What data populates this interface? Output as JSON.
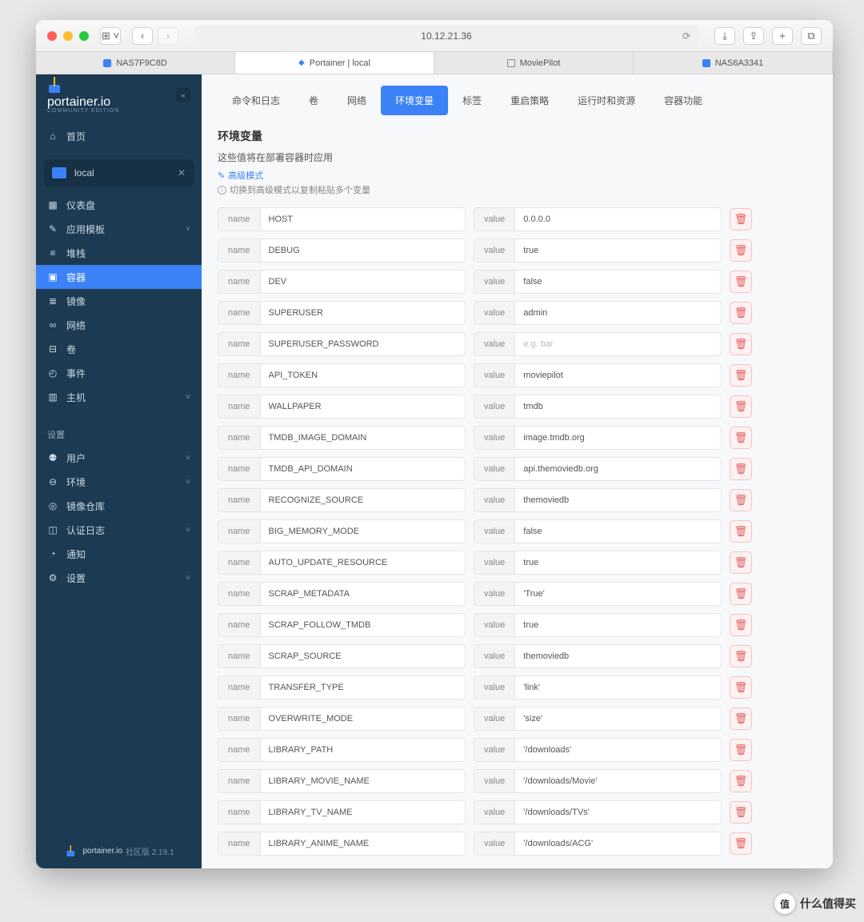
{
  "browser": {
    "url": "10.12.21.36",
    "tabs": [
      {
        "label": "NAS7F9C8D"
      },
      {
        "label": "Portainer | local"
      },
      {
        "label": "MoviePilot"
      },
      {
        "label": "NAS6A3341"
      }
    ]
  },
  "sidebar": {
    "brand": "portainer.io",
    "edition": "COMMUNITY EDITION",
    "home": "首页",
    "env": "local",
    "items": [
      {
        "icon": "▦",
        "label": "仪表盘"
      },
      {
        "icon": "✎",
        "label": "应用模板",
        "chev": true
      },
      {
        "icon": "≡",
        "label": "堆栈"
      },
      {
        "icon": "▣",
        "label": "容器",
        "sel": true
      },
      {
        "icon": "≣",
        "label": "镜像"
      },
      {
        "icon": "∞",
        "label": "网络"
      },
      {
        "icon": "⊟",
        "label": "卷"
      },
      {
        "icon": "◴",
        "label": "事件"
      },
      {
        "icon": "▥",
        "label": "主机",
        "chev": true
      }
    ],
    "settings_label": "设置",
    "settings": [
      {
        "icon": "⚉",
        "label": "用户",
        "chev": true
      },
      {
        "icon": "⊖",
        "label": "环境",
        "chev": true
      },
      {
        "icon": "◎",
        "label": "镜像仓库"
      },
      {
        "icon": "◫",
        "label": "认证日志",
        "chev": true
      },
      {
        "icon": "◔",
        "label": "通知"
      },
      {
        "icon": "⚙",
        "label": "设置",
        "chev": true
      }
    ],
    "footer_brand": "portainer.io",
    "footer_version": "社区版 2.19.1"
  },
  "content": {
    "tabs": [
      "命令和日志",
      "卷",
      "网络",
      "环境变量",
      "标签",
      "重启策略",
      "运行时和资源",
      "容器功能"
    ],
    "active_tab": 3,
    "section_title": "环境变量",
    "section_sub": "这些值将在部署容器时应用",
    "advanced": "高级模式",
    "hint": "切换到高级模式以复制粘贴多个变量",
    "name_label": "name",
    "value_label": "value",
    "placeholder_value": "e.g. bar",
    "env": [
      {
        "name": "HOST",
        "value": "0.0.0.0"
      },
      {
        "name": "DEBUG",
        "value": "true"
      },
      {
        "name": "DEV",
        "value": "false"
      },
      {
        "name": "SUPERUSER",
        "value": "admin"
      },
      {
        "name": "SUPERUSER_PASSWORD",
        "value": ""
      },
      {
        "name": "API_TOKEN",
        "value": "moviepilot"
      },
      {
        "name": "WALLPAPER",
        "value": "tmdb"
      },
      {
        "name": "TMDB_IMAGE_DOMAIN",
        "value": "image.tmdb.org"
      },
      {
        "name": "TMDB_API_DOMAIN",
        "value": "api.themoviedb.org"
      },
      {
        "name": "RECOGNIZE_SOURCE",
        "value": "themoviedb"
      },
      {
        "name": "BIG_MEMORY_MODE",
        "value": "false"
      },
      {
        "name": "AUTO_UPDATE_RESOURCE",
        "value": "true"
      },
      {
        "name": "SCRAP_METADATA",
        "value": "'True'"
      },
      {
        "name": "SCRAP_FOLLOW_TMDB",
        "value": "true"
      },
      {
        "name": "SCRAP_SOURCE",
        "value": "themoviedb"
      },
      {
        "name": "TRANSFER_TYPE",
        "value": "'link'"
      },
      {
        "name": "OVERWRITE_MODE",
        "value": "'size'"
      },
      {
        "name": "LIBRARY_PATH",
        "value": "'/downloads'"
      },
      {
        "name": "LIBRARY_MOVIE_NAME",
        "value": "'/downloads/Movie'"
      },
      {
        "name": "LIBRARY_TV_NAME",
        "value": "'/downloads/TVs'"
      },
      {
        "name": "LIBRARY_ANIME_NAME",
        "value": "'/downloads/ACG'"
      }
    ]
  },
  "watermark": "什么值得买"
}
